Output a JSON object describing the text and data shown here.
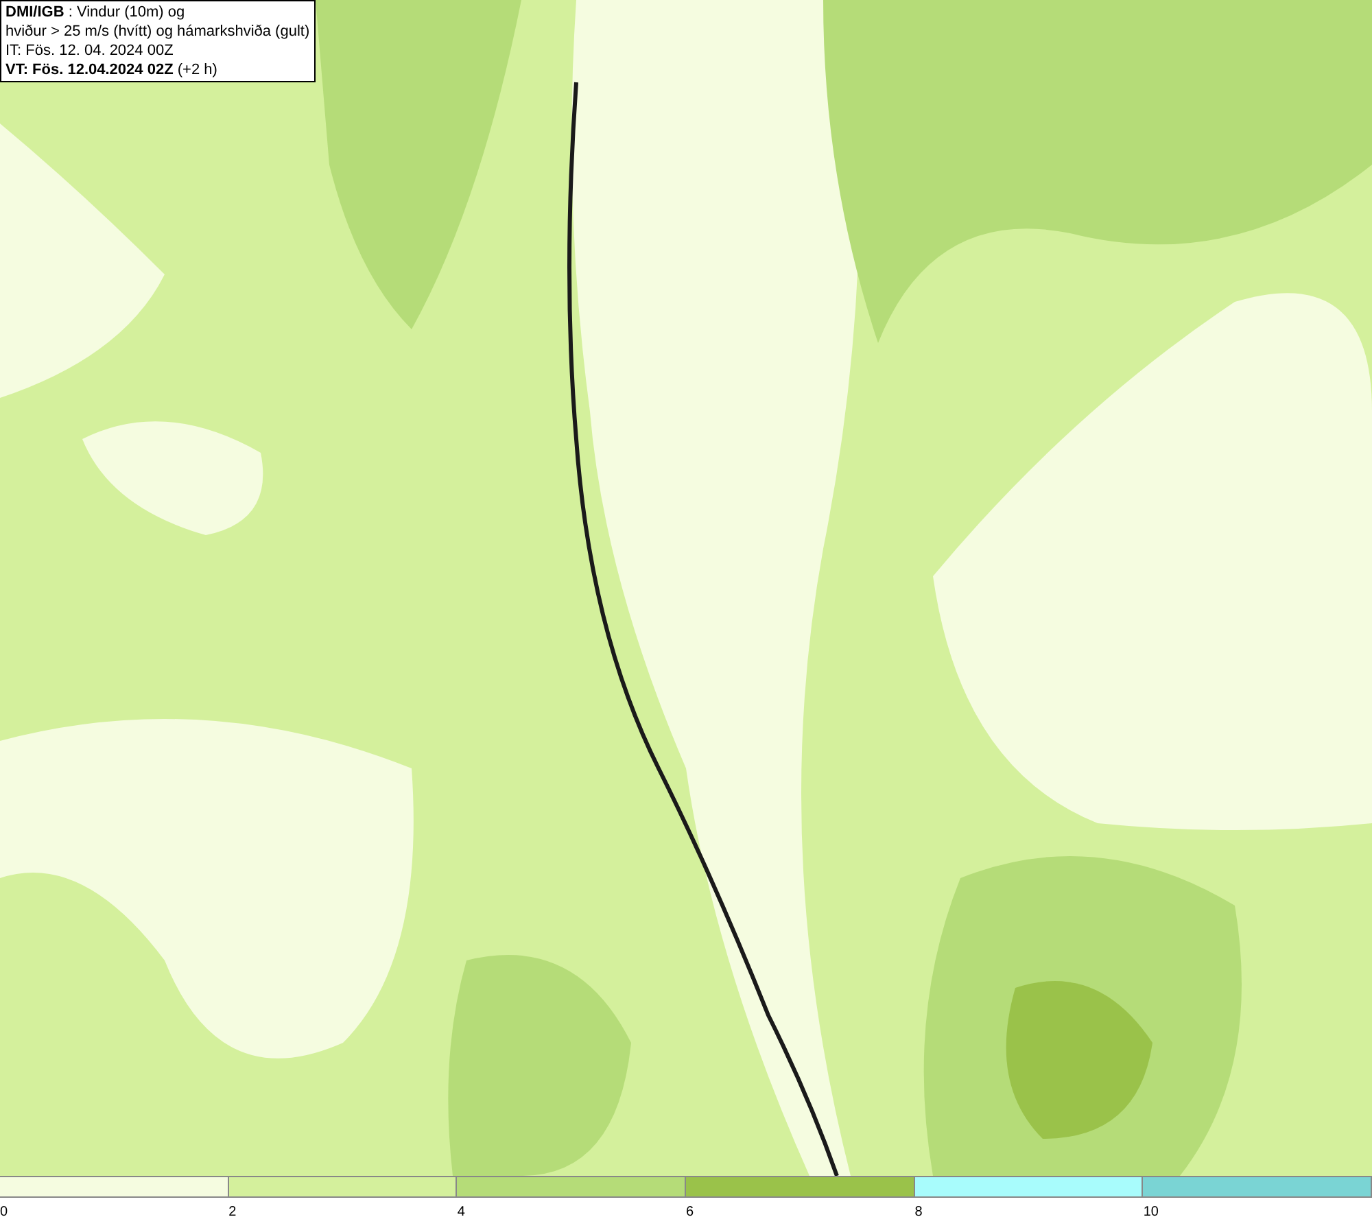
{
  "title_box": {
    "lines": [
      "**DMI/IGB** : Vindur (10m) og",
      "hviður > 25 m/s (hvítt) og hámarkshviða (gult)",
      "IT: Fös. 12. 04. 2024 00Z",
      "**VT: Fös. 12.04.2024 02Z** (+2 h)"
    ]
  },
  "legend": [
    {
      "label": "0",
      "color": "#f5fce0"
    },
    {
      "label": "2",
      "color": "#d4f09c"
    },
    {
      "label": "4",
      "color": "#b5dc78"
    },
    {
      "label": "6",
      "color": "#9ac24a"
    },
    {
      "label": "8",
      "color": "#a8fcfc"
    },
    {
      "label": "10",
      "color": "#7ad4d4"
    }
  ]
}
